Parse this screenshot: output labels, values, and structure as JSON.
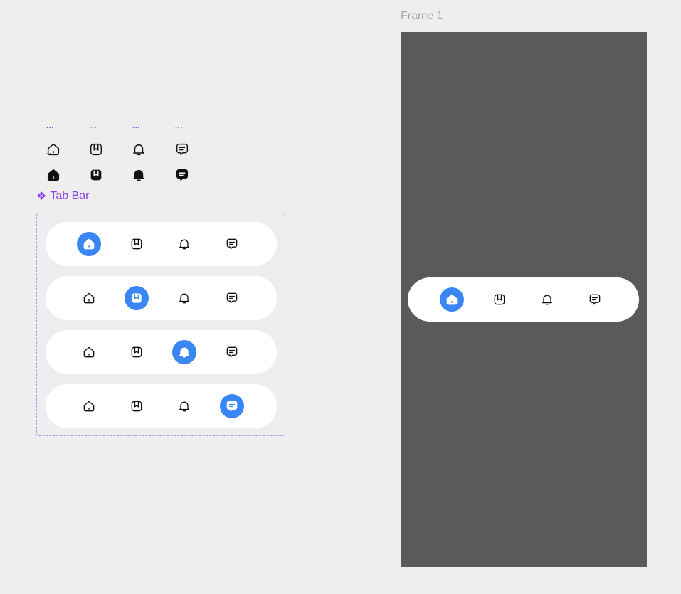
{
  "icon_set": {
    "outline": [
      {
        "icon": "home-outline-icon"
      },
      {
        "icon": "bookmark-outline-icon"
      },
      {
        "icon": "bell-outline-icon"
      },
      {
        "icon": "chat-outline-icon"
      }
    ],
    "filled": [
      {
        "icon": "home-filled-icon"
      },
      {
        "icon": "bookmark-filled-icon"
      },
      {
        "icon": "bell-filled-icon"
      },
      {
        "icon": "chat-filled-icon"
      }
    ]
  },
  "component": {
    "title_glyph": "❖",
    "title": "Tab Bar",
    "variants": [
      {
        "active_index": 0
      },
      {
        "active_index": 1
      },
      {
        "active_index": 2
      },
      {
        "active_index": 3
      }
    ],
    "tabs": [
      "home",
      "bookmark",
      "bell",
      "chat"
    ]
  },
  "frame": {
    "label": "Frame 1",
    "tabbar_active_index": 0
  },
  "colors": {
    "canvas": "#eeeeee",
    "component_accent": "#8b3ff0",
    "active_tab": "#3a86f5",
    "frame_fill": "#5a5a5a",
    "tabbar_bg": "#ffffff"
  }
}
